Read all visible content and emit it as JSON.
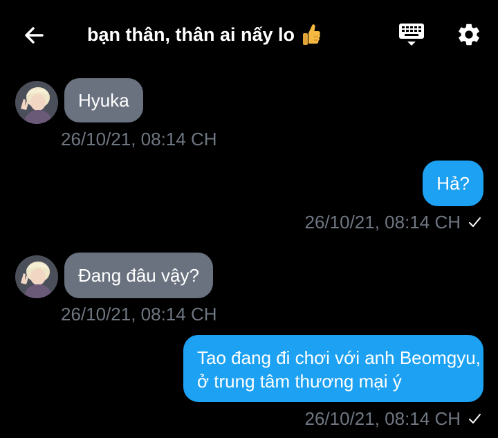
{
  "header": {
    "title": "bạn thân, thân ai nấy lo",
    "title_emoji": "thumbs-up-icon",
    "icons": [
      "back-arrow-icon",
      "keyboard-icon",
      "gear-icon"
    ]
  },
  "colors": {
    "background": "#000000",
    "incoming_bubble": "#6a7280",
    "outgoing_bubble": "#1da1f2",
    "timestamp": "#6f7782"
  },
  "messages": [
    {
      "direction": "incoming",
      "text": "Hyuka",
      "timestamp": "26/10/21, 08:14 CH"
    },
    {
      "direction": "outgoing",
      "text": "Hả?",
      "timestamp": "26/10/21, 08:14 CH",
      "status": "sent-check"
    },
    {
      "direction": "incoming",
      "text": "Đang đâu vậy?",
      "timestamp": "26/10/21, 08:14 CH"
    },
    {
      "direction": "outgoing",
      "lines": [
        "Tao đang đi chơi với anh Beomgyu,",
        "ở trung tâm thương mại ý"
      ],
      "timestamp": "26/10/21, 08:14 CH",
      "status": "sent-check"
    }
  ]
}
